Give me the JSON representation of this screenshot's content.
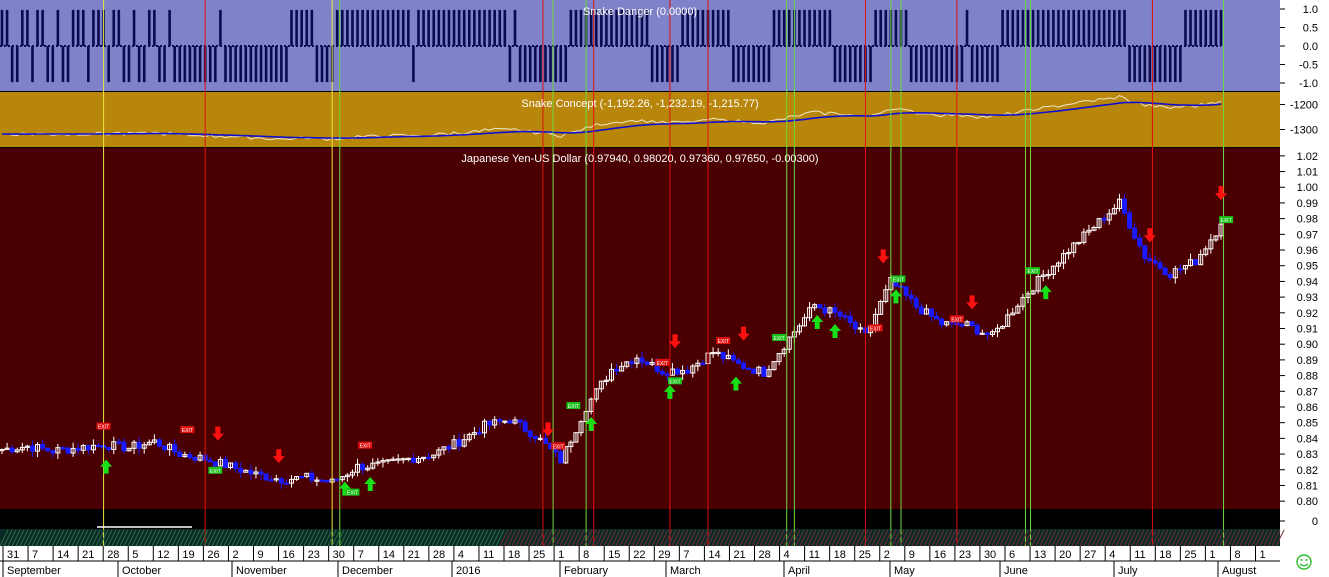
{
  "colors": {
    "danger_bg": "#7f82c8",
    "danger_bar": "#0a0a50",
    "concept_bg": "#b8860b",
    "price_bg": "#4a0000",
    "bottom_band": "#000000",
    "bull_candle": "#ffffff",
    "bear_candle": "#1a1aff",
    "green_line": "#6cdc3c",
    "red_line": "#e01010",
    "yellow_line": "#e8e840",
    "axis_bg": "#ffffff"
  },
  "panels": {
    "danger": {
      "title": "Snake Danger (0.0000)",
      "ticks": [
        "1.0",
        "0.5",
        "0.0",
        "-0.5",
        "-1.0"
      ]
    },
    "concept": {
      "title": "Snake Concept (-1,192.26, -1,232.19, -1,215.77)",
      "ticks": [
        "-1200",
        "-1300"
      ]
    },
    "price": {
      "title": "Japanese Yen-US Dollar (0.97940, 0.98020, 0.97360, 0.97650, -0.00300)",
      "ticks": [
        "1.02",
        "1.01",
        "1.00",
        "0.99",
        "0.98",
        "0.97",
        "0.96",
        "0.95",
        "0.94",
        "0.93",
        "0.92",
        "0.91",
        "0.90",
        "0.89",
        "0.88",
        "0.87",
        "0.86",
        "0.85",
        "0.84",
        "0.83",
        "0.82",
        "0.81",
        "0.80"
      ],
      "bottom_tick": "0"
    }
  },
  "date_axis": {
    "days": [
      "31",
      "7",
      "14",
      "21",
      "28",
      "5",
      "12",
      "19",
      "26",
      "2",
      "9",
      "16",
      "23",
      "30",
      "7",
      "14",
      "21",
      "28",
      "4",
      "11",
      "18",
      "25",
      "1",
      "8",
      "15",
      "22",
      "29",
      "7",
      "14",
      "21",
      "28",
      "4",
      "11",
      "18",
      "25",
      "2",
      "9",
      "16",
      "23",
      "30",
      "6",
      "13",
      "20",
      "27",
      "4",
      "11",
      "18",
      "25",
      "1",
      "8",
      "1"
    ],
    "months": [
      "September",
      "October",
      "November",
      "December",
      "2016",
      "February",
      "March",
      "April",
      "May",
      "June",
      "July",
      "August"
    ]
  },
  "signals": {
    "exit_label": "EXIT"
  },
  "chart_data": {
    "type": "candlestick",
    "title": "Japanese Yen-US Dollar (0.97940, 0.98020, 0.97360, 0.97650, -0.00300)",
    "ylim": [
      0.795,
      1.025
    ],
    "weekly_close": [
      {
        "week": "Aug 31",
        "close": 0.833
      },
      {
        "week": "Sep 7",
        "close": 0.835
      },
      {
        "week": "Sep 14",
        "close": 0.832
      },
      {
        "week": "Sep 21",
        "close": 0.834
      },
      {
        "week": "Sep 28",
        "close": 0.836
      },
      {
        "week": "Oct 5",
        "close": 0.834
      },
      {
        "week": "Oct 12",
        "close": 0.838
      },
      {
        "week": "Oct 19",
        "close": 0.83
      },
      {
        "week": "Oct 26",
        "close": 0.827
      },
      {
        "week": "Nov 2",
        "close": 0.822
      },
      {
        "week": "Nov 9",
        "close": 0.817
      },
      {
        "week": "Nov 16",
        "close": 0.814
      },
      {
        "week": "Nov 23",
        "close": 0.815
      },
      {
        "week": "Nov 30",
        "close": 0.812
      },
      {
        "week": "Dec 7",
        "close": 0.822
      },
      {
        "week": "Dec 14",
        "close": 0.823
      },
      {
        "week": "Dec 21",
        "close": 0.827
      },
      {
        "week": "Dec 28",
        "close": 0.83
      },
      {
        "week": "Jan 4",
        "close": 0.838
      },
      {
        "week": "Jan 11",
        "close": 0.848
      },
      {
        "week": "Jan 18",
        "close": 0.852
      },
      {
        "week": "Jan 25",
        "close": 0.842
      },
      {
        "week": "Feb 1",
        "close": 0.826
      },
      {
        "week": "Feb 8",
        "close": 0.86
      },
      {
        "week": "Feb 15",
        "close": 0.884
      },
      {
        "week": "Feb 22",
        "close": 0.892
      },
      {
        "week": "Feb 29",
        "close": 0.883
      },
      {
        "week": "Mar 7",
        "close": 0.884
      },
      {
        "week": "Mar 14",
        "close": 0.895
      },
      {
        "week": "Mar 21",
        "close": 0.887
      },
      {
        "week": "Mar 28",
        "close": 0.882
      },
      {
        "week": "Apr 4",
        "close": 0.904
      },
      {
        "week": "Apr 11",
        "close": 0.925
      },
      {
        "week": "Apr 18",
        "close": 0.918
      },
      {
        "week": "Apr 25",
        "close": 0.905
      },
      {
        "week": "May 2",
        "close": 0.94
      },
      {
        "week": "May 9",
        "close": 0.924
      },
      {
        "week": "May 16",
        "close": 0.913
      },
      {
        "week": "May 23",
        "close": 0.912
      },
      {
        "week": "May 30",
        "close": 0.905
      },
      {
        "week": "Jun 6",
        "close": 0.926
      },
      {
        "week": "Jun 13",
        "close": 0.944
      },
      {
        "week": "Jun 20",
        "close": 0.96
      },
      {
        "week": "Jun 27",
        "close": 0.975
      },
      {
        "week": "Jul 4",
        "close": 0.99
      },
      {
        "week": "Jul 11",
        "close": 0.956
      },
      {
        "week": "Jul 18",
        "close": 0.945
      },
      {
        "week": "Jul 25",
        "close": 0.953
      },
      {
        "week": "Aug 1",
        "close": 0.9765
      }
    ],
    "snake_concept_ylim": [
      -1370,
      -1150
    ],
    "snake_danger_ylim": [
      -1.1,
      1.1
    ]
  }
}
